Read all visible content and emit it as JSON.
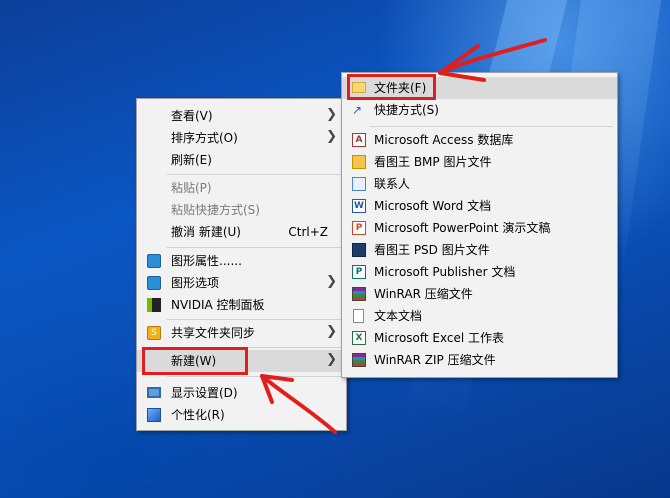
{
  "context_menu": {
    "items": [
      {
        "label": "查看(V)",
        "submenu": true
      },
      {
        "label": "排序方式(O)",
        "submenu": true
      },
      {
        "label": "刷新(E)"
      },
      {
        "label": "粘贴(P)",
        "disabled": true
      },
      {
        "label": "粘贴快捷方式(S)",
        "disabled": true
      },
      {
        "label": "撤消 新建(U)",
        "shortcut": "Ctrl+Z"
      },
      {
        "label": "图形属性......",
        "icon": "graphics-properties-icon"
      },
      {
        "label": "图形选项",
        "icon": "graphics-options-icon",
        "submenu": true
      },
      {
        "label": "NVIDIA 控制面板",
        "icon": "nvidia-icon"
      },
      {
        "label": "共享文件夹同步",
        "icon": "share-sync-icon",
        "submenu": true
      },
      {
        "label": "新建(W)",
        "submenu": true,
        "highlighted": true
      },
      {
        "label": "显示设置(D)",
        "icon": "display-icon"
      },
      {
        "label": "个性化(R)",
        "icon": "personalize-icon"
      }
    ]
  },
  "new_submenu": {
    "items": [
      {
        "label": "文件夹(F)",
        "icon": "folder-icon",
        "highlighted": true
      },
      {
        "label": "快捷方式(S)",
        "icon": "shortcut-icon"
      },
      {
        "label": "Microsoft Access 数据库",
        "icon": "access-icon"
      },
      {
        "label": "看图王 BMP 图片文件",
        "icon": "bmp-icon"
      },
      {
        "label": "联系人",
        "icon": "contact-icon"
      },
      {
        "label": "Microsoft Word 文档",
        "icon": "word-icon"
      },
      {
        "label": "Microsoft PowerPoint 演示文稿",
        "icon": "powerpoint-icon"
      },
      {
        "label": "看图王 PSD 图片文件",
        "icon": "psd-icon"
      },
      {
        "label": "Microsoft Publisher 文档",
        "icon": "publisher-icon"
      },
      {
        "label": "WinRAR 压缩文件",
        "icon": "winrar-icon"
      },
      {
        "label": "文本文档",
        "icon": "text-document-icon"
      },
      {
        "label": "Microsoft Excel 工作表",
        "icon": "excel-icon"
      },
      {
        "label": "WinRAR ZIP 压缩文件",
        "icon": "winrar-zip-icon"
      }
    ]
  },
  "colors": {
    "annotation_red": "#e11d1d",
    "menu_bg": "#f2f2f2",
    "highlight": "#dadada"
  }
}
